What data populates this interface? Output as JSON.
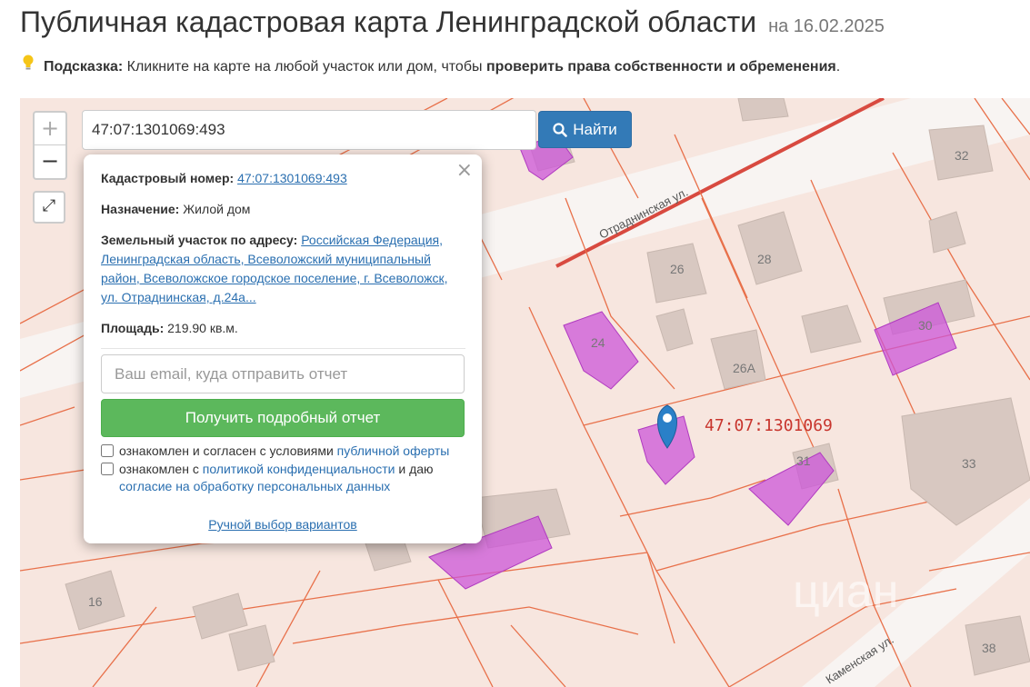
{
  "header": {
    "title": "Публичная кадастровая карта Ленинградской области",
    "date": "на 16.02.2025"
  },
  "hint": {
    "prefix": "Подсказка:",
    "text": " Кликните на карте на любой участок или дом, чтобы ",
    "bold": "проверить права собственности и обременения",
    "suffix": "."
  },
  "search": {
    "value": "47:07:1301069:493",
    "button_label": "Найти"
  },
  "map": {
    "zoom_in": "+",
    "zoom_out": "−",
    "streets": [
      "Отраднинская ул.",
      "Каменская ул."
    ],
    "house_numbers": [
      "32",
      "26",
      "28",
      "24",
      "30",
      "26А",
      "31",
      "33",
      "16",
      "38"
    ],
    "cadastral_block": "47:07:1301069",
    "watermark": "циан",
    "colors": {
      "background": "#f7e6df",
      "parcel_border": "#e8704a",
      "building": "#d8c8c1",
      "highlight": "#cc55d8",
      "road": "#f8f4f2",
      "marker": "#2a80c8"
    }
  },
  "popup": {
    "close": "×",
    "cadastral_label": "Кадастровый номер:",
    "cadastral_value": "47:07:1301069:493",
    "purpose_label": "Назначение:",
    "purpose_value": "Жилой дом",
    "address_label": "Земельный участок по адресу:",
    "address_value": "Российская Федерация, Ленинградская область, Всеволожский муниципальный район, Всеволожское городское поселение, г. Всеволожск, ул. Отраднинская, д.24а...",
    "area_label": "Площадь:",
    "area_value": "219.90 кв.м.",
    "email_placeholder": "Ваш email, куда отправить отчет",
    "report_button": "Получить подробный отчет",
    "consent1_text": "ознакомлен и согласен с условиями ",
    "consent1_link": "публичной оферты",
    "consent2_text": "ознакомлен с ",
    "consent2_link": "политикой конфиденциальности",
    "consent2_mid": " и даю ",
    "consent2_link2": "согласие на обработку персональных данных",
    "manual_link": "Ручной выбор вариантов"
  }
}
